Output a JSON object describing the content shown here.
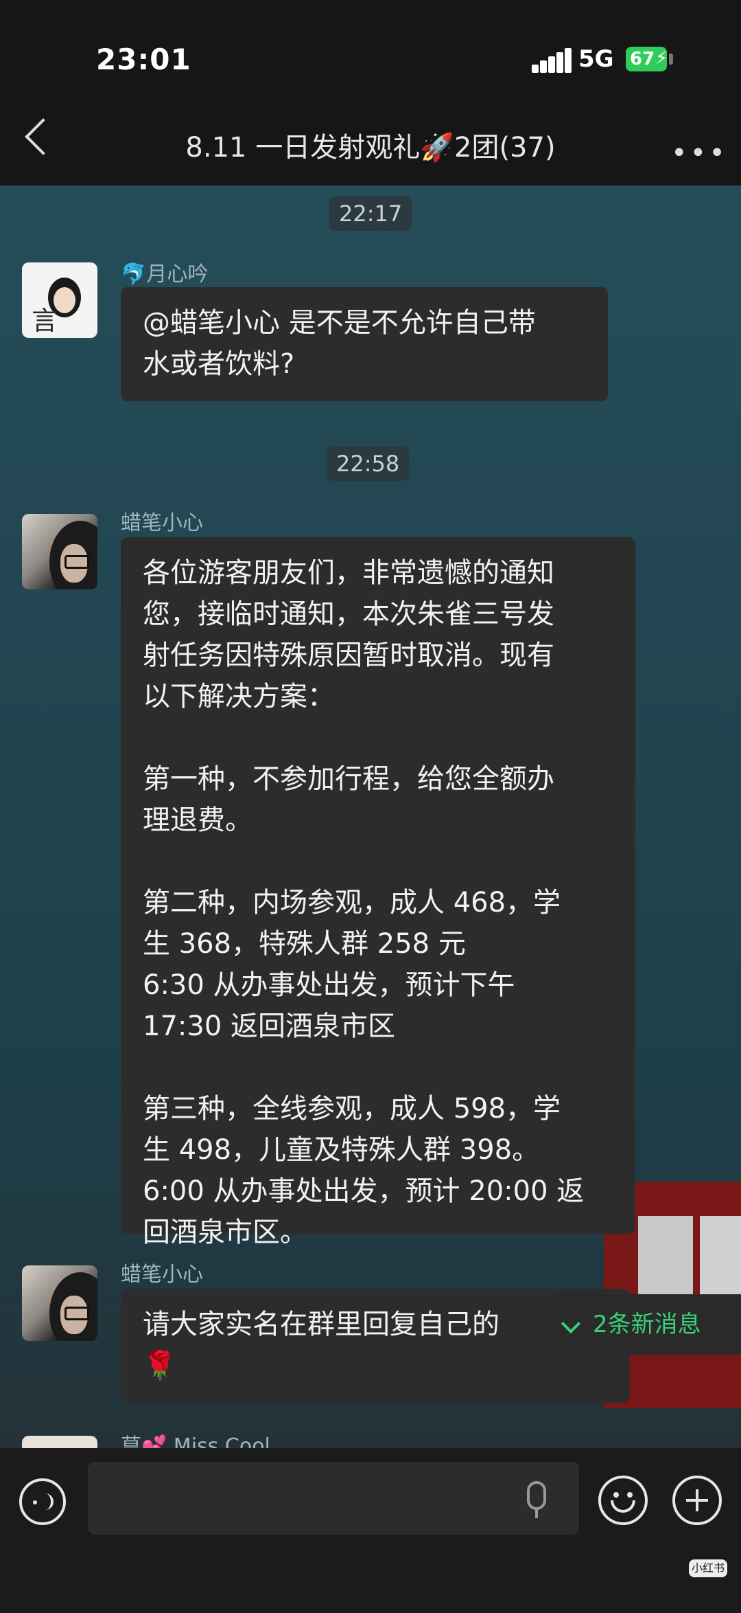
{
  "status_bar": {
    "time": "23:01",
    "network": "5G",
    "battery": "67"
  },
  "nav": {
    "title": "8.11 一日发射观礼🚀2团(37)",
    "more": "•••"
  },
  "timestamps": [
    "22:17",
    "22:58"
  ],
  "messages": [
    {
      "sender": "🐬月心吟",
      "avatar_text": "言",
      "text": "@蜡笔小心 是不是不允许自己带\n水或者饮料?"
    },
    {
      "sender": "蜡笔小心",
      "text": "各位游客朋友们，非常遗憾的通知\n您，接临时通知，本次朱雀三号发\n射任务因特殊原因暂时取消。现有\n以下解决方案：\n\n第一种，不参加行程，给您全额办\n理退费。\n\n第二种，内场参观，成人 468，学\n生 368，特殊人群 258 元\n6:30 从办事处出发，预计下午\n17:30 返回酒泉市区\n\n第三种，全线参观，成人 598，学\n生 498，儿童及特殊人群 398。\n6:00 从办事处出发，预计 20:00 返\n回酒泉市区。"
    },
    {
      "sender": "蜡笔小心",
      "text": "请大家实名在群里回复自己的\n🌹"
    },
    {
      "sender": "䓍💕 Miss Cool"
    }
  ],
  "new_messages": "2条新消息",
  "watermark": "小红书",
  "icons": [
    "back-icon",
    "more-icon",
    "voice-icon",
    "mic-icon",
    "emoji-icon",
    "plus-icon",
    "chevron-double-down-icon"
  ],
  "colors": {
    "bg_chat": "#22444f",
    "bubble": "#2c2c2c",
    "accent_green": "#3bd07a",
    "battery": "#2fcc59"
  }
}
